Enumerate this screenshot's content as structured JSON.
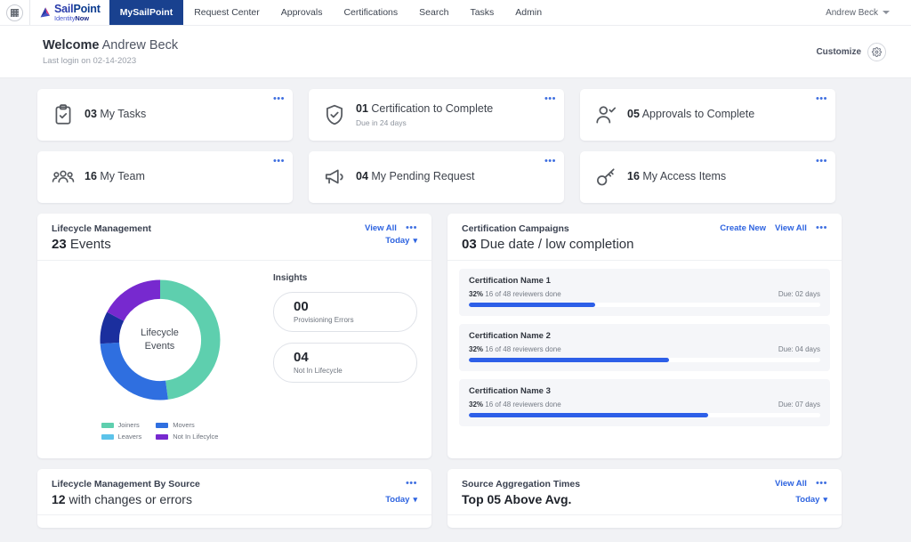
{
  "nav": {
    "grid_icon": "app-grid-icon",
    "brand": {
      "line1_a": "Sail",
      "line1_b": "Point",
      "line2_a": "Identity",
      "line2_b": "Now"
    },
    "items": [
      {
        "label": "MySailPoint",
        "active": true
      },
      {
        "label": "Request Center",
        "active": false
      },
      {
        "label": "Approvals",
        "active": false
      },
      {
        "label": "Certifications",
        "active": false
      },
      {
        "label": "Search",
        "active": false
      },
      {
        "label": "Tasks",
        "active": false
      },
      {
        "label": "Admin",
        "active": false
      }
    ],
    "user": {
      "name": "Andrew Beck",
      "caret_icon": "chevron-down-icon"
    }
  },
  "welcome": {
    "greeting": "Welcome",
    "user": "Andrew Beck",
    "last_login": "Last login on 02-14-2023",
    "customize_label": "Customize",
    "gear_icon": "gear-icon"
  },
  "tiles": [
    {
      "icon": "clipboard-check-icon",
      "count": "03",
      "label": "My Tasks",
      "sub": "",
      "menu": "•••"
    },
    {
      "icon": "shield-check-icon",
      "count": "01",
      "label": "Certification to Complete",
      "sub": "Due in 24 days",
      "menu": "•••"
    },
    {
      "icon": "user-check-icon",
      "count": "05",
      "label": "Approvals to Complete",
      "sub": "",
      "menu": "•••"
    },
    {
      "icon": "people-group-icon",
      "count": "16",
      "label": "My Team",
      "sub": "",
      "menu": "•••"
    },
    {
      "icon": "megaphone-icon",
      "count": "04",
      "label": "My Pending Request",
      "sub": "",
      "menu": "•••"
    },
    {
      "icon": "key-icon",
      "count": "16",
      "label": "My Access Items",
      "sub": "",
      "menu": "•••"
    }
  ],
  "lifecycle": {
    "title": "Lifecycle Management",
    "count": "23",
    "count_label": "Events",
    "view_all": "View All",
    "menu": "•••",
    "period": "Today",
    "period_caret": "chevron-down-icon",
    "donut_center_line1": "Lifecycle",
    "donut_center_line2": "Events",
    "insights_title": "Insights",
    "insights": [
      {
        "value": "00",
        "label": "Provisioning Errors"
      },
      {
        "value": "04",
        "label": "Not In Lifecycle"
      }
    ],
    "legend": [
      {
        "label": "Joiners",
        "color": "#5ecfae"
      },
      {
        "label": "Movers",
        "color": "#2f6fe0"
      },
      {
        "label": "Leavers",
        "color": "#5cc3ea"
      },
      {
        "label": "Not In Lifecylce",
        "color": "#7729cf"
      }
    ]
  },
  "chart_data": {
    "type": "pie",
    "title": "Lifecycle Events",
    "subtype": "donut",
    "total": 23,
    "categories": [
      "Joiners",
      "Movers",
      "Leavers",
      "Not In Lifecylce"
    ],
    "values": [
      11,
      6,
      2,
      4
    ],
    "percentages": [
      47.8,
      26.1,
      8.7,
      17.4
    ],
    "colors": [
      "#5ecfae",
      "#2f6fe0",
      "#1b2f9e",
      "#7729cf"
    ],
    "legend_position": "bottom",
    "grid": false
  },
  "campaigns": {
    "title": "Certification Campaigns",
    "count": "03",
    "count_label": "Due date / low completion",
    "create_new": "Create New",
    "view_all": "View All",
    "menu": "•••",
    "rows": [
      {
        "name": "Certification Name 1",
        "percent": "32%",
        "detail": "16 of 48 reviewers done",
        "due": "Due: 02 days",
        "fill": 36
      },
      {
        "name": "Certification Name 2",
        "percent": "32%",
        "detail": "16 of 48 reviewers done",
        "due": "Due: 04 days",
        "fill": 57
      },
      {
        "name": "Certification Name 3",
        "percent": "32%",
        "detail": "16 of 48 reviewers done",
        "due": "Due: 07 days",
        "fill": 68
      }
    ]
  },
  "lcm_by_source": {
    "title": "Lifecycle Management By Source",
    "count": "12",
    "count_label": "with changes or errors",
    "menu": "•••",
    "period": "Today"
  },
  "source_agg": {
    "title": "Source Aggregation Times",
    "headline": "Top 05 Above Avg.",
    "view_all": "View All",
    "menu": "•••",
    "period": "Today"
  }
}
